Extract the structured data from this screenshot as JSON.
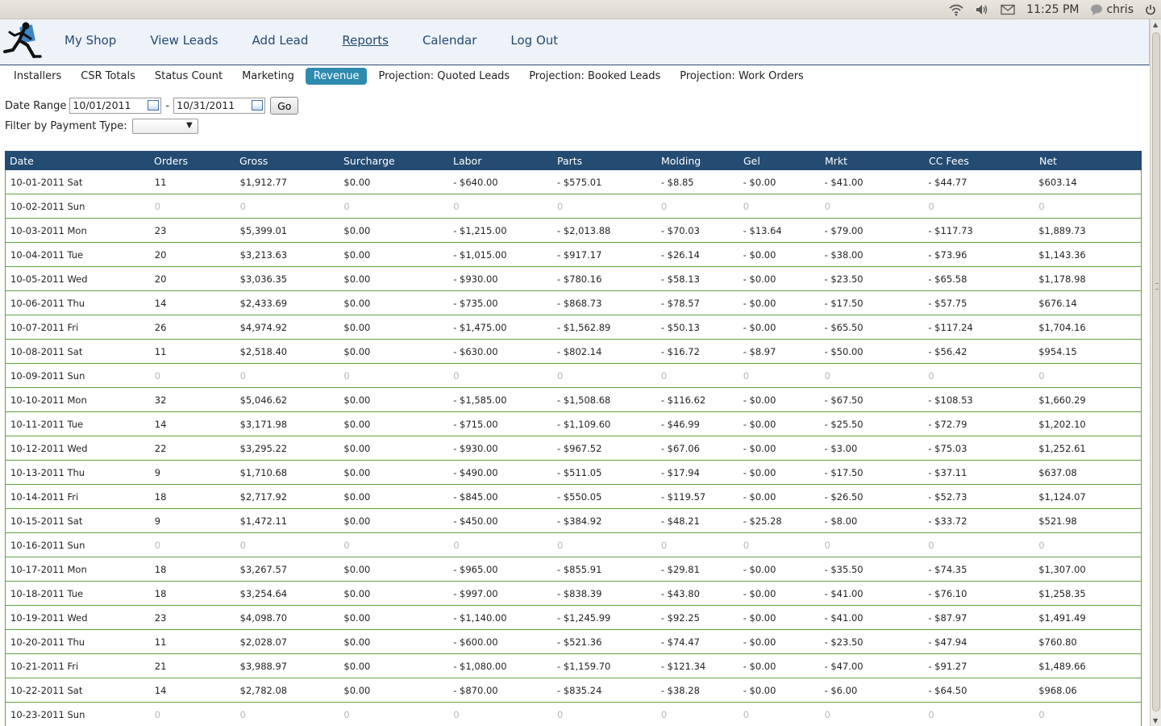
{
  "os": {
    "time": "11:25 PM",
    "user": "chris",
    "icons": [
      "wifi-icon",
      "volume-icon",
      "mail-icon",
      "chat-icon",
      "power-icon"
    ]
  },
  "nav": {
    "items": [
      "My Shop",
      "View Leads",
      "Add Lead",
      "Reports",
      "Calendar",
      "Log Out"
    ],
    "active": "Reports"
  },
  "subnav": {
    "items": [
      "Installers",
      "CSR Totals",
      "Status Count",
      "Marketing",
      "Revenue",
      "Projection: Quoted Leads",
      "Projection: Booked Leads",
      "Projection: Work Orders"
    ],
    "active": "Revenue",
    "active_color": "#2e8bb0"
  },
  "filters": {
    "date_range_label": "Date Range",
    "start_date": "10/01/2011",
    "separator": "-",
    "end_date": "10/31/2011",
    "go_label": "Go",
    "payment_label": "Filter by Payment Type:",
    "payment_value": ""
  },
  "table": {
    "header_color": "#244b72",
    "row_border_color": "#5fa341",
    "columns": [
      "Date",
      "Orders",
      "Gross",
      "Surcharge",
      "Labor",
      "Parts",
      "Molding",
      "Gel",
      "Mrkt",
      "CC Fees",
      "Net"
    ],
    "rows": [
      [
        "10-01-2011 Sat",
        "11",
        "$1,912.77",
        "$0.00",
        "- $640.00",
        "- $575.01",
        "- $8.85",
        "- $0.00",
        "- $41.00",
        "- $44.77",
        "$603.14"
      ],
      [
        "10-02-2011 Sun",
        "0",
        "0",
        "0",
        "0",
        "0",
        "0",
        "0",
        "0",
        "0",
        "0"
      ],
      [
        "10-03-2011 Mon",
        "23",
        "$5,399.01",
        "$0.00",
        "- $1,215.00",
        "- $2,013.88",
        "- $70.03",
        "- $13.64",
        "- $79.00",
        "- $117.73",
        "$1,889.73"
      ],
      [
        "10-04-2011 Tue",
        "20",
        "$3,213.63",
        "$0.00",
        "- $1,015.00",
        "- $917.17",
        "- $26.14",
        "- $0.00",
        "- $38.00",
        "- $73.96",
        "$1,143.36"
      ],
      [
        "10-05-2011 Wed",
        "20",
        "$3,036.35",
        "$0.00",
        "- $930.00",
        "- $780.16",
        "- $58.13",
        "- $0.00",
        "- $23.50",
        "- $65.58",
        "$1,178.98"
      ],
      [
        "10-06-2011 Thu",
        "14",
        "$2,433.69",
        "$0.00",
        "- $735.00",
        "- $868.73",
        "- $78.57",
        "- $0.00",
        "- $17.50",
        "- $57.75",
        "$676.14"
      ],
      [
        "10-07-2011 Fri",
        "26",
        "$4,974.92",
        "$0.00",
        "- $1,475.00",
        "- $1,562.89",
        "- $50.13",
        "- $0.00",
        "- $65.50",
        "- $117.24",
        "$1,704.16"
      ],
      [
        "10-08-2011 Sat",
        "11",
        "$2,518.40",
        "$0.00",
        "- $630.00",
        "- $802.14",
        "- $16.72",
        "- $8.97",
        "- $50.00",
        "- $56.42",
        "$954.15"
      ],
      [
        "10-09-2011 Sun",
        "0",
        "0",
        "0",
        "0",
        "0",
        "0",
        "0",
        "0",
        "0",
        "0"
      ],
      [
        "10-10-2011 Mon",
        "32",
        "$5,046.62",
        "$0.00",
        "- $1,585.00",
        "- $1,508.68",
        "- $116.62",
        "- $0.00",
        "- $67.50",
        "- $108.53",
        "$1,660.29"
      ],
      [
        "10-11-2011 Tue",
        "14",
        "$3,171.98",
        "$0.00",
        "- $715.00",
        "- $1,109.60",
        "- $46.99",
        "- $0.00",
        "- $25.50",
        "- $72.79",
        "$1,202.10"
      ],
      [
        "10-12-2011 Wed",
        "22",
        "$3,295.22",
        "$0.00",
        "- $930.00",
        "- $967.52",
        "- $67.06",
        "- $0.00",
        "- $3.00",
        "- $75.03",
        "$1,252.61"
      ],
      [
        "10-13-2011 Thu",
        "9",
        "$1,710.68",
        "$0.00",
        "- $490.00",
        "- $511.05",
        "- $17.94",
        "- $0.00",
        "- $17.50",
        "- $37.11",
        "$637.08"
      ],
      [
        "10-14-2011 Fri",
        "18",
        "$2,717.92",
        "$0.00",
        "- $845.00",
        "- $550.05",
        "- $119.57",
        "- $0.00",
        "- $26.50",
        "- $52.73",
        "$1,124.07"
      ],
      [
        "10-15-2011 Sat",
        "9",
        "$1,472.11",
        "$0.00",
        "- $450.00",
        "- $384.92",
        "- $48.21",
        "- $25.28",
        "- $8.00",
        "- $33.72",
        "$521.98"
      ],
      [
        "10-16-2011 Sun",
        "0",
        "0",
        "0",
        "0",
        "0",
        "0",
        "0",
        "0",
        "0",
        "0"
      ],
      [
        "10-17-2011 Mon",
        "18",
        "$3,267.57",
        "$0.00",
        "- $965.00",
        "- $855.91",
        "- $29.81",
        "- $0.00",
        "- $35.50",
        "- $74.35",
        "$1,307.00"
      ],
      [
        "10-18-2011 Tue",
        "18",
        "$3,254.64",
        "$0.00",
        "- $997.00",
        "- $838.39",
        "- $43.80",
        "- $0.00",
        "- $41.00",
        "- $76.10",
        "$1,258.35"
      ],
      [
        "10-19-2011 Wed",
        "23",
        "$4,098.70",
        "$0.00",
        "- $1,140.00",
        "- $1,245.99",
        "- $92.25",
        "- $0.00",
        "- $41.00",
        "- $87.97",
        "$1,491.49"
      ],
      [
        "10-20-2011 Thu",
        "11",
        "$2,028.07",
        "$0.00",
        "- $600.00",
        "- $521.36",
        "- $74.47",
        "- $0.00",
        "- $23.50",
        "- $47.94",
        "$760.80"
      ],
      [
        "10-21-2011 Fri",
        "21",
        "$3,988.97",
        "$0.00",
        "- $1,080.00",
        "- $1,159.70",
        "- $121.34",
        "- $0.00",
        "- $47.00",
        "- $91.27",
        "$1,489.66"
      ],
      [
        "10-22-2011 Sat",
        "14",
        "$2,782.08",
        "$0.00",
        "- $870.00",
        "- $835.24",
        "- $38.28",
        "- $0.00",
        "- $6.00",
        "- $64.50",
        "$968.06"
      ],
      [
        "10-23-2011 Sun",
        "0",
        "0",
        "0",
        "0",
        "0",
        "0",
        "0",
        "0",
        "0",
        "0"
      ]
    ]
  }
}
